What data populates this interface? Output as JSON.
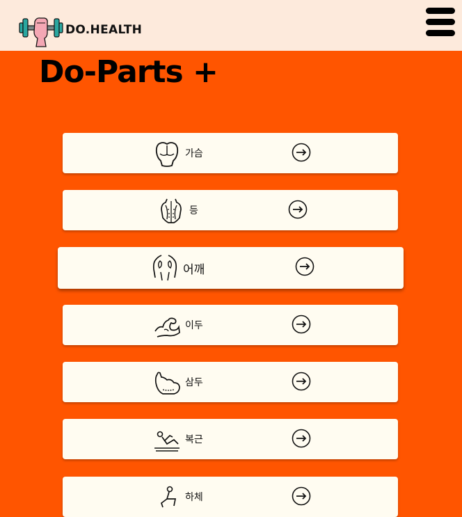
{
  "header": {
    "brand": "DO.HEALTH"
  },
  "main": {
    "title": "Do-Parts +",
    "parts": [
      {
        "label": "가슴",
        "icon": "chest-icon"
      },
      {
        "label": "등",
        "icon": "back-muscle-icon"
      },
      {
        "label": "어깨",
        "icon": "shoulder-icon"
      },
      {
        "label": "이두",
        "icon": "bicep-icon"
      },
      {
        "label": "삼두",
        "icon": "tricep-icon"
      },
      {
        "label": "복근",
        "icon": "situp-icon"
      },
      {
        "label": "하체",
        "icon": "leg-icon"
      }
    ]
  },
  "colors": {
    "background": "#ff5500",
    "header": "#fdeadc",
    "card": "#fffcf1"
  }
}
